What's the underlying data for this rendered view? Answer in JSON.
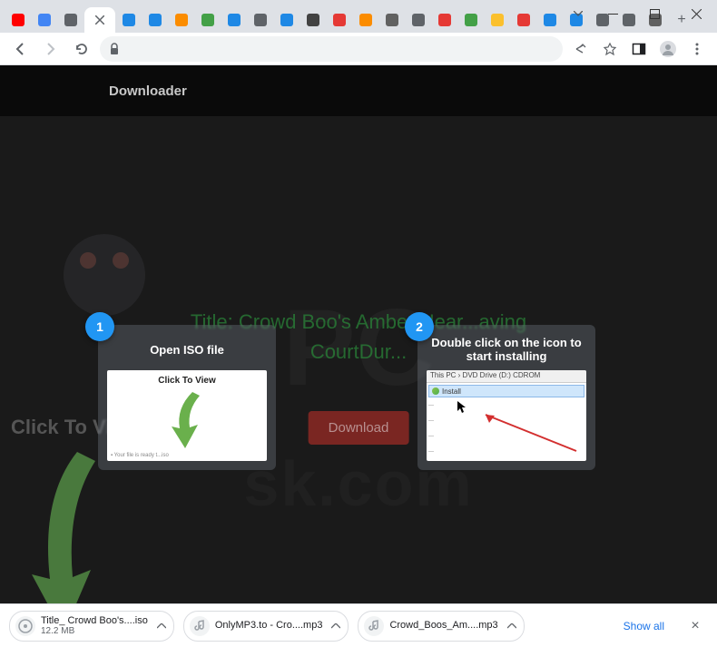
{
  "window": {
    "dropdown_icon": "chevron-down",
    "minimize_icon": "minimize",
    "maximize_icon": "maximize",
    "close_icon": "close"
  },
  "tabs": {
    "items": [
      {
        "icon": "youtube",
        "color": "#ff0000"
      },
      {
        "icon": "google",
        "color": "#4285f4"
      },
      {
        "icon": "globe",
        "color": "#5f6368"
      },
      {
        "icon": "close",
        "color": "#5f6368",
        "active": true
      },
      {
        "icon": "cloud-dl",
        "color": "#1e88e5"
      },
      {
        "icon": "cloud-dl",
        "color": "#1e88e5"
      },
      {
        "icon": "puzzle",
        "color": "#fb8c00"
      },
      {
        "icon": "grid",
        "color": "#43a047"
      },
      {
        "icon": "grid4",
        "color": "#1e88e5"
      },
      {
        "icon": "globe",
        "color": "#5f6368"
      },
      {
        "icon": "play",
        "color": "#1e88e5"
      },
      {
        "icon": "disc",
        "color": "#424242"
      },
      {
        "icon": "dl",
        "color": "#e53935"
      },
      {
        "icon": "dl-box",
        "color": "#fb8c00"
      },
      {
        "icon": "phone",
        "color": "#616161"
      },
      {
        "icon": "globe",
        "color": "#5f6368"
      },
      {
        "icon": "play-box",
        "color": "#e53935"
      },
      {
        "icon": "grid-g",
        "color": "#43a047"
      },
      {
        "icon": "dl-y",
        "color": "#fbc02d"
      },
      {
        "icon": "ym",
        "color": "#e53935"
      },
      {
        "icon": "cloud",
        "color": "#1e88e5"
      },
      {
        "icon": "b",
        "color": "#1e88e5"
      },
      {
        "icon": "globe",
        "color": "#5f6368"
      },
      {
        "icon": "globe",
        "color": "#5f6368"
      },
      {
        "icon": "gear",
        "color": "#616161"
      }
    ],
    "new_tab": "+"
  },
  "nav": {
    "back": "←",
    "forward": "→",
    "reload": "⟳",
    "lock_icon": "lock",
    "share_icon": "share",
    "star_icon": "star",
    "panel_icon": "panel",
    "user_icon": "user",
    "menu_icon": "menu"
  },
  "page": {
    "header": "Downloader",
    "watermark1": "PC",
    "watermark2": "sk.com",
    "click_to_view": "Click To View",
    "content_title": "Title: Crowd Boo's Amber Hear...aving CourtDur...",
    "download_btn": "Download"
  },
  "cards": [
    {
      "num": "1",
      "title": "Open ISO file",
      "preview_label": "Click To View"
    },
    {
      "num": "2",
      "title": "Double click on the icon to start installing",
      "explorer_path": "This PC › DVD Drive (D:) CDROM",
      "install_label": "Install"
    }
  ],
  "downloads": {
    "items": [
      {
        "name": "Title_ Crowd Boo's....iso",
        "sub": "12.2 MB",
        "icon": "disc"
      },
      {
        "name": "OnlyMP3.to - Cro....mp3",
        "sub": "",
        "icon": "audio"
      },
      {
        "name": "Crowd_Boos_Am....mp3",
        "sub": "",
        "icon": "audio"
      }
    ],
    "show_all": "Show all",
    "close": "×"
  }
}
